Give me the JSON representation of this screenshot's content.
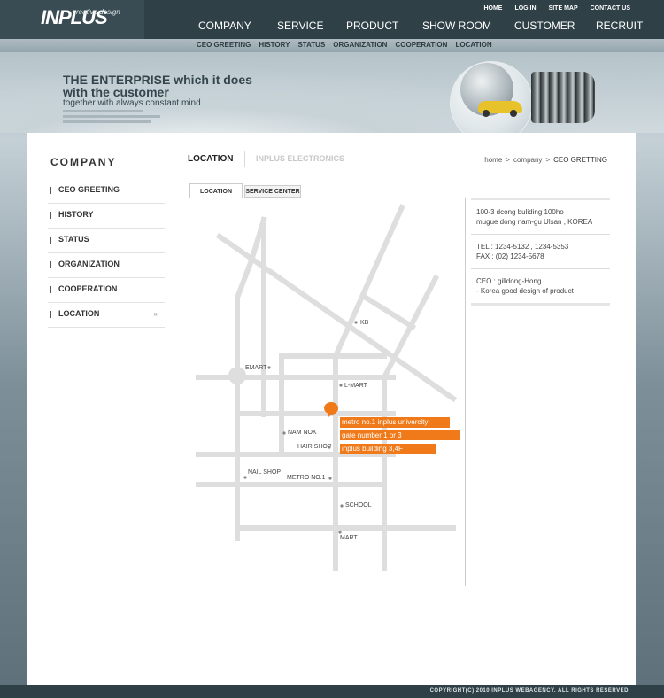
{
  "logo": {
    "brand": "INPLUS",
    "tagline": "creative design"
  },
  "util_nav": [
    "HOME",
    "LOG IN",
    "SITE MAP",
    "CONTACT US"
  ],
  "main_nav": [
    "COMPANY",
    "SERVICE",
    "PRODUCT",
    "SHOW ROOM",
    "CUSTOMER",
    "RECRUIT"
  ],
  "sub_nav": [
    "CEO GREETING",
    "HISTORY",
    "STATUS",
    "ORGANIZATION",
    "COOPERATION",
    "LOCATION"
  ],
  "hero": {
    "title_line1": "THE ENTERPRISE which it does",
    "title_line2": "with the customer",
    "subtitle": "together with always constant mind"
  },
  "side_menu": {
    "title": "COMPANY",
    "items": [
      "CEO GREETING",
      "HISTORY",
      "STATUS",
      "ORGANIZATION",
      "COOPERATION",
      "LOCATION"
    ],
    "active_arrow": "»"
  },
  "page_header": {
    "title": "LOCATION",
    "secondary": "INPLUS ELECTRONICS",
    "breadcrumb": [
      "home",
      "company",
      "CEO GRETTING"
    ],
    "breadcrumb_sep": ">"
  },
  "tabs": [
    "LOCATION",
    "SERVICE CENTER"
  ],
  "map": {
    "labels": [
      "KB",
      "EMART",
      "L-MART",
      "NAM NOK",
      "HAIR SHOP",
      "NAIL SHOP",
      "METRO NO.1",
      "SCHOOL",
      "MART"
    ],
    "callout": [
      "metro no.1 inplus univercity",
      "gate number 1 or 3",
      "inplus building 3,4F"
    ],
    "accent_color": "#f07a1a",
    "road_color": "#dedede"
  },
  "info": {
    "address_line1": "100-3 dcong buliding 100ho",
    "address_line2": "mugue dong nam-gu Ulsan , KOREA",
    "tel_label": "TEL",
    "tel": ": 1234-5132 , 1234-5353",
    "fax_label": "FAX",
    "fax": ": (02) 1234-5678",
    "ceo_label": "CEO",
    "ceo": ": gilldong-Hong",
    "slogan": "- Korea good design of product"
  },
  "footer": {
    "copyright": "COPYRIGHT(C) 2010 INPLUS WEBAGENCY. ALL RIGHTS RESERVED"
  }
}
